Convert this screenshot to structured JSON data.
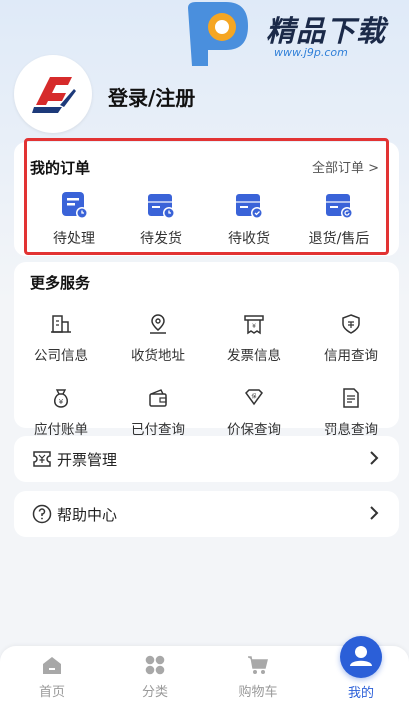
{
  "watermark": {
    "brand": "精品下载",
    "url": "www.j9p.com"
  },
  "profile": {
    "login_label": "登录/注册"
  },
  "orders": {
    "title": "我的订单",
    "all_label": "全部订单 >",
    "items": [
      {
        "label": "待处理",
        "icon": "pending-icon"
      },
      {
        "label": "待发货",
        "icon": "to-ship-icon"
      },
      {
        "label": "待收货",
        "icon": "to-receive-icon"
      },
      {
        "label": "退货/售后",
        "icon": "return-icon"
      }
    ]
  },
  "services": {
    "title": "更多服务",
    "items": [
      {
        "label": "公司信息",
        "icon": "company-icon"
      },
      {
        "label": "收货地址",
        "icon": "location-icon"
      },
      {
        "label": "发票信息",
        "icon": "invoice-icon"
      },
      {
        "label": "信用查询",
        "icon": "credit-icon"
      },
      {
        "label": "应付账单",
        "icon": "bill-icon"
      },
      {
        "label": "已付查询",
        "icon": "wallet-icon"
      },
      {
        "label": "价保查询",
        "icon": "price-protect-icon"
      },
      {
        "label": "罚息查询",
        "icon": "penalty-icon"
      }
    ]
  },
  "rows": [
    {
      "label": "开票管理",
      "icon": "ticket-icon"
    },
    {
      "label": "帮助中心",
      "icon": "help-icon"
    }
  ],
  "tabbar": {
    "items": [
      {
        "label": "首页",
        "icon": "home-icon"
      },
      {
        "label": "分类",
        "icon": "category-icon"
      },
      {
        "label": "购物车",
        "icon": "cart-icon"
      },
      {
        "label": "我的",
        "icon": "user-icon",
        "active": true
      }
    ]
  },
  "colors": {
    "accent": "#2b5fd8",
    "highlight_border": "#e23333",
    "order_icon": "#3a63d8"
  }
}
